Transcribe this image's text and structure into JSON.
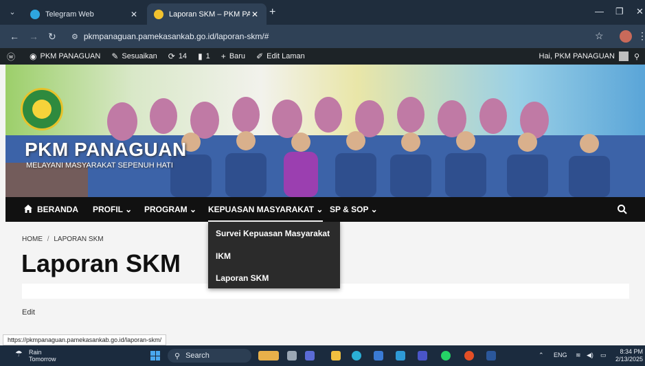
{
  "browser": {
    "tabs": [
      {
        "label": "Telegram Web",
        "active": false
      },
      {
        "label": "Laporan SKM – PKM PANAGUAN",
        "active": true
      }
    ],
    "url": "pkmpanaguan.pamekasankab.go.id/laporan-skm/#",
    "status_url": "https://pkmpanaguan.pamekasankab.go.id/laporan-skm/"
  },
  "wp_admin_bar": {
    "site_name": "PKM PANAGUAN",
    "customize": "Sesuaikan",
    "updates": "14",
    "comments": "1",
    "new": "Baru",
    "edit_page": "Edit Laman",
    "greeting": "Hai, PKM PANAGUAN"
  },
  "header": {
    "title": "PKM PANAGUAN",
    "tagline": "MELAYANI MASYARAKAT SEPENUH HATI"
  },
  "nav": {
    "items": [
      {
        "label": "BERANDA"
      },
      {
        "label": "PROFIL"
      },
      {
        "label": "PROGRAM"
      },
      {
        "label": "KEPUASAN MASYARAKAT"
      },
      {
        "label": "SP & SOP"
      }
    ],
    "dropdown": [
      "Survei Kepuasan Masyarakat",
      "IKM",
      "Laporan SKM"
    ]
  },
  "page": {
    "breadcrumb_home": "HOME",
    "breadcrumb_sep": "/",
    "breadcrumb_current": "LAPORAN SKM",
    "title": "Laporan SKM",
    "edit": "Edit"
  },
  "taskbar": {
    "weather_title": "Rain",
    "weather_sub": "Tomorrow",
    "search": "Search",
    "lang": "ENG",
    "time": "8:34 PM",
    "date": "2/13/2025"
  },
  "colors": {
    "nav_bg": "#111111",
    "dropdown_bg": "#2b2b2b",
    "wpbar_bg": "#1d2327",
    "chrome_bg": "#1f2d3d"
  }
}
